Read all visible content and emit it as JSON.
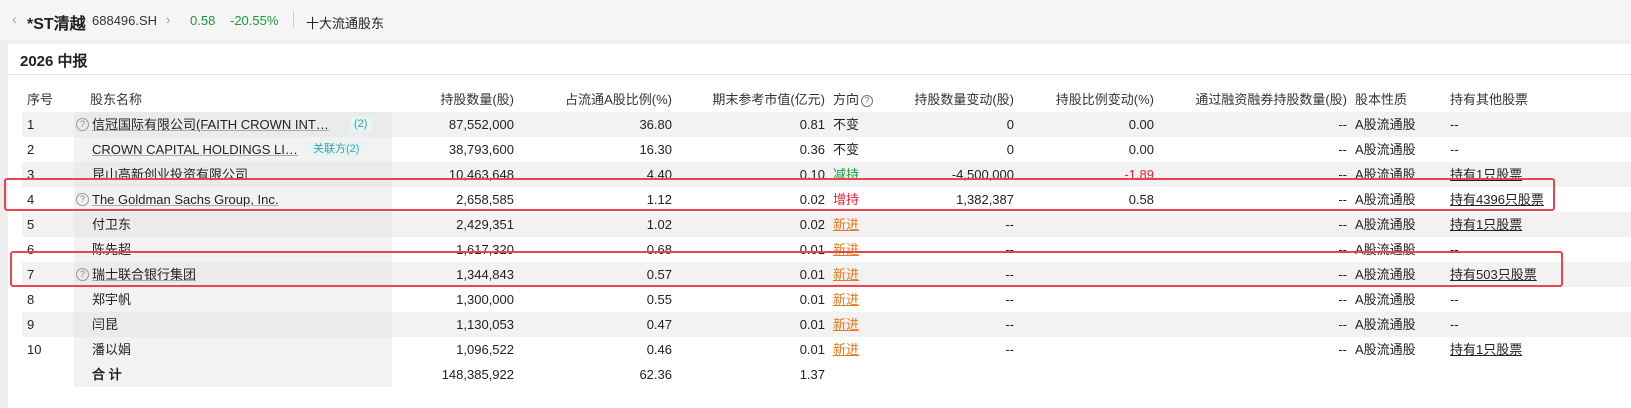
{
  "header": {
    "back": "‹",
    "stock_name": "*ST清越",
    "stock_code": "688496.SH",
    "chevron": "›",
    "price": "0.58",
    "change_pct": "-20.55%",
    "section": "十大流通股东"
  },
  "panel": {
    "title": "2026 中报"
  },
  "columns": {
    "index": "序号",
    "holder": "股东名称",
    "shares": "持股数量(股)",
    "ratio": "占流通A股比例(%)",
    "value": "期末参考市值(亿元)",
    "direction": "方向",
    "share_change": "持股数量变动(股)",
    "ratio_change": "持股比例变动(%)",
    "margin": "通过融资融券持股数量(股)",
    "nature": "股本性质",
    "other": "持有其他股票"
  },
  "rows": [
    {
      "index": "1",
      "name": "信冠国际有限公司(FAITH CROWN INT…",
      "badge": "(2)",
      "shares": "87,552,000",
      "ratio": "36.80",
      "value": "0.81",
      "direction": "不变",
      "share_change": "0",
      "ratio_change": "0.00",
      "margin": "--",
      "nature": "A股流通股",
      "other": "--"
    },
    {
      "index": "2",
      "name": "CROWN CAPITAL HOLDINGS LI…",
      "badge": "关联方(2)",
      "shares": "38,793,600",
      "ratio": "16.30",
      "value": "0.36",
      "direction": "不变",
      "share_change": "0",
      "ratio_change": "0.00",
      "margin": "--",
      "nature": "A股流通股",
      "other": "--"
    },
    {
      "index": "3",
      "name": "昆山高新创业投资有限公司",
      "shares": "10,463,648",
      "ratio": "4.40",
      "value": "0.10",
      "direction": "减持",
      "share_change": "-4,500,000",
      "ratio_change": "-1.89",
      "margin": "--",
      "nature": "A股流通股",
      "other": "持有1只股票"
    },
    {
      "index": "4",
      "name": "The Goldman Sachs Group, Inc.",
      "shares": "2,658,585",
      "ratio": "1.12",
      "value": "0.02",
      "direction": "增持",
      "share_change": "1,382,387",
      "ratio_change": "0.58",
      "margin": "--",
      "nature": "A股流通股",
      "other": "持有4396只股票"
    },
    {
      "index": "5",
      "name": "付卫东",
      "shares": "2,429,351",
      "ratio": "1.02",
      "value": "0.02",
      "direction": "新进",
      "share_change": "--",
      "ratio_change": "",
      "margin": "--",
      "nature": "A股流通股",
      "other": "持有1只股票"
    },
    {
      "index": "6",
      "name": "陈先超",
      "shares": "1,617,320",
      "ratio": "0.68",
      "value": "0.01",
      "direction": "新进",
      "share_change": "--",
      "ratio_change": "",
      "margin": "--",
      "nature": "A股流通股",
      "other": "--"
    },
    {
      "index": "7",
      "name": "瑞士联合银行集团",
      "shares": "1,344,843",
      "ratio": "0.57",
      "value": "0.01",
      "direction": "新进",
      "share_change": "--",
      "ratio_change": "",
      "margin": "--",
      "nature": "A股流通股",
      "other": "持有503只股票"
    },
    {
      "index": "8",
      "name": "郑宇帆",
      "shares": "1,300,000",
      "ratio": "0.55",
      "value": "0.01",
      "direction": "新进",
      "share_change": "--",
      "ratio_change": "",
      "margin": "--",
      "nature": "A股流通股",
      "other": "--"
    },
    {
      "index": "9",
      "name": "闫昆",
      "shares": "1,130,053",
      "ratio": "0.47",
      "value": "0.01",
      "direction": "新进",
      "share_change": "--",
      "ratio_change": "",
      "margin": "--",
      "nature": "A股流通股",
      "other": "--"
    },
    {
      "index": "10",
      "name": "潘以娟",
      "shares": "1,096,522",
      "ratio": "0.46",
      "value": "0.01",
      "direction": "新进",
      "share_change": "--",
      "ratio_change": "",
      "margin": "--",
      "nature": "A股流通股",
      "other": "持有1只股票"
    }
  ],
  "total": {
    "label": "合 计",
    "shares": "148,385,922",
    "ratio": "62.36",
    "value": "1.37"
  },
  "help_icon": "?",
  "colors": {
    "up": "#e22233",
    "down": "#1a9a3a",
    "new": "#e57a1a",
    "highlight": "#e8454d",
    "badge": "#3aa3a3"
  }
}
